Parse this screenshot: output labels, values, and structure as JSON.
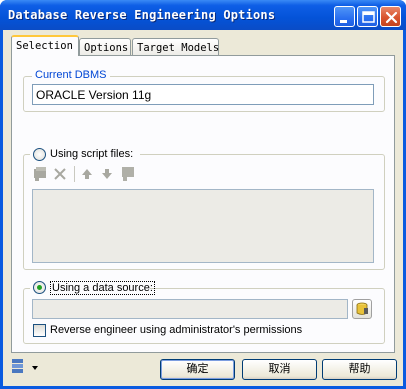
{
  "window": {
    "title": "Database Reverse Engineering Options"
  },
  "tabs": [
    {
      "label": "Selection",
      "active": true
    },
    {
      "label": "Options",
      "active": false
    },
    {
      "label": "Target Models",
      "active": false
    }
  ],
  "current_dbms": {
    "legend": "Current DBMS",
    "value": "ORACLE Version 11g"
  },
  "script_files": {
    "label": "Using script files:",
    "selected": false,
    "toolbar": [
      "add-files-icon",
      "delete-icon",
      "move-up-icon",
      "move-down-icon",
      "clear-icon"
    ]
  },
  "data_source": {
    "label": "Using a data source:",
    "selected": true,
    "value": "",
    "admin_checkbox_label": "Reverse engineer using administrator's permissions",
    "admin_checked": false
  },
  "buttons": {
    "ok": "确定",
    "cancel": "取消",
    "help": "帮助"
  },
  "colors": {
    "title_bar": "#0a5be0",
    "dialog_bg": "#ece9d8",
    "legend_text": "#0046d5",
    "active_tab_accent": "#ffc83c"
  }
}
